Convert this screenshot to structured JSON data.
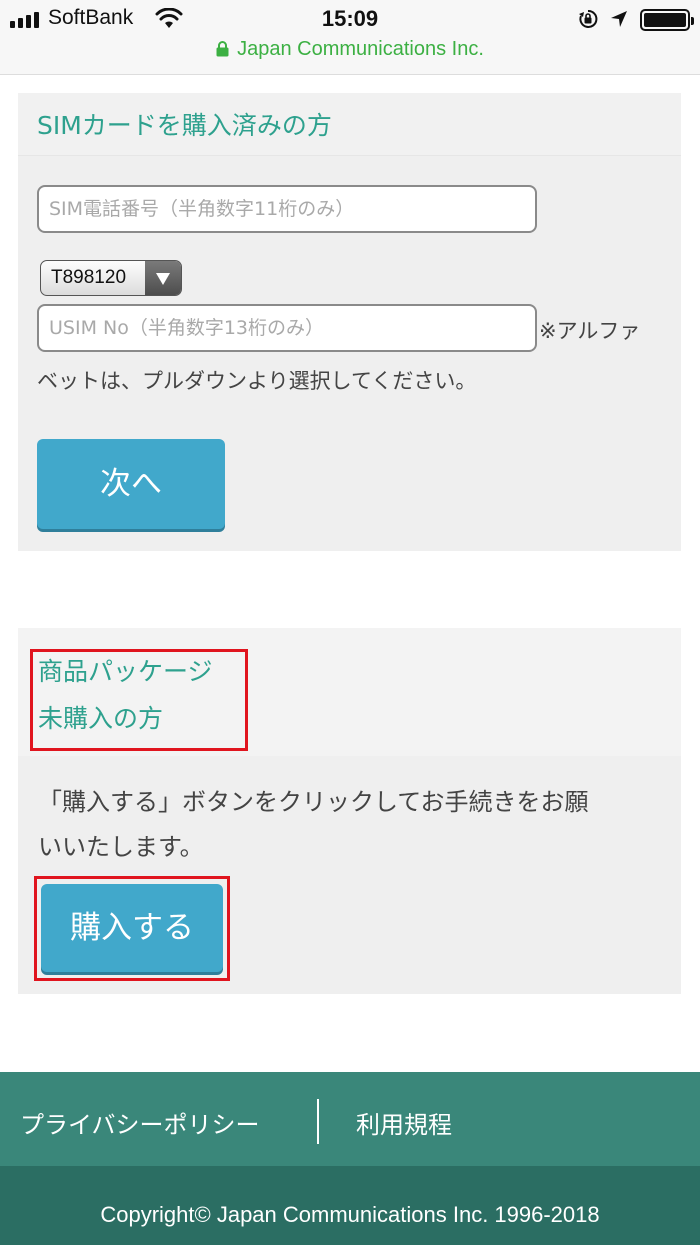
{
  "status_bar": {
    "carrier": "SoftBank",
    "time": "15:09",
    "icons": [
      "signal-bars-icon",
      "wifi-icon",
      "orientation-lock-icon",
      "location-arrow-icon",
      "battery-icon"
    ]
  },
  "url_bar": {
    "site": "Japan Communications Inc.",
    "icon": "lock-icon",
    "color": "#3cb043"
  },
  "sim_section": {
    "title": "SIMカードを購入済みの方",
    "phone_placeholder": "SIM電話番号（半角数字11桁のみ）",
    "phone_value": "",
    "prefix_select": "T898120",
    "usim_placeholder": "USIM No（半角数字13桁のみ）",
    "usim_value": "",
    "note_part1": "※アルファ",
    "note_part2": "ベットは、プルダウンより選択してください。",
    "next_button": "次へ"
  },
  "package_section": {
    "title_line1": "商品パッケージ",
    "title_line2": "未購入の方",
    "desc_line1": "「購入する」ボタンをクリックしてお手続きをお願",
    "desc_line2": "いいたします。",
    "buy_button": "購入する"
  },
  "footer": {
    "privacy_link": "プライバシーポリシー",
    "terms_link": "利用規程",
    "copyright": "Copyright© Japan Communications Inc. 1996-2018"
  },
  "colors": {
    "accent_text": "#2ea18e",
    "button": "#41a8cb",
    "highlight_box": "#e0141e",
    "footer_top": "#3a877a",
    "footer_bottom": "#2b6e63"
  }
}
